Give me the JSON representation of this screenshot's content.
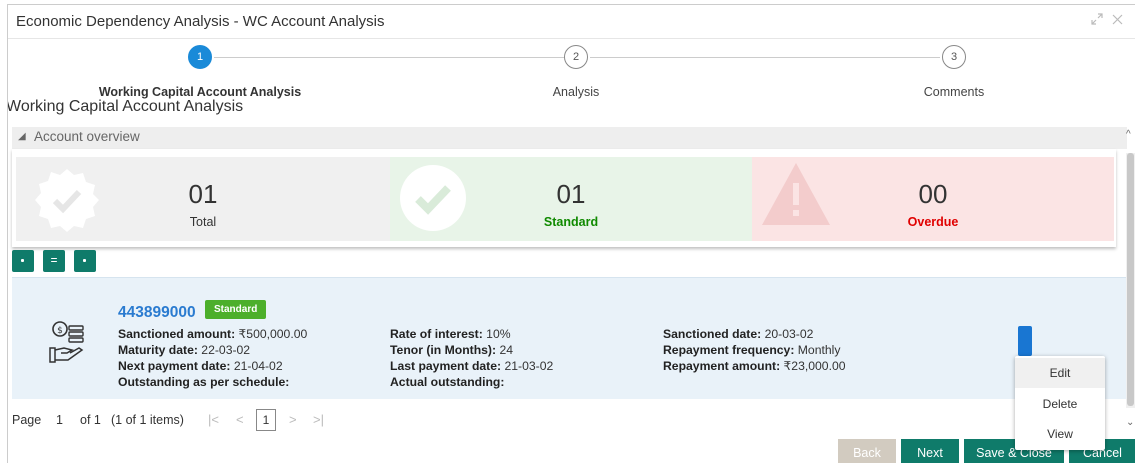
{
  "window": {
    "title": "Economic Dependency Analysis - WC Account Analysis"
  },
  "stepper": {
    "steps": [
      {
        "number": "1",
        "label": "Working Capital Account Analysis",
        "active": true
      },
      {
        "number": "2",
        "label": "Analysis",
        "active": false
      },
      {
        "number": "3",
        "label": "Comments",
        "active": false
      }
    ]
  },
  "page_heading": "Working Capital Account Analysis",
  "overview": {
    "section_label": "Account overview",
    "cards": [
      {
        "count": "01",
        "label": "Total",
        "color": "#f0f0f0",
        "label_color": "#333333"
      },
      {
        "count": "01",
        "label": "Standard",
        "color": "#e8f4e8",
        "label_color": "#108a00"
      },
      {
        "count": "00",
        "label": "Overdue",
        "color": "#fbe4e4",
        "label_color": "#e00000"
      }
    ]
  },
  "account": {
    "number": "443899000",
    "status": "Standard",
    "fields": {
      "sanctioned_amount_label": "Sanctioned amount:",
      "sanctioned_amount_value": "₹500,000.00",
      "maturity_date_label": "Maturity date:",
      "maturity_date_value": "22-03-02",
      "next_payment_date_label": "Next payment date:",
      "next_payment_date_value": "21-04-02",
      "outstanding_schedule_label": "Outstanding as per schedule:",
      "rate_of_interest_label": "Rate of interest:",
      "rate_of_interest_value": "10%",
      "tenor_label": "Tenor (in Months):",
      "tenor_value": "24",
      "last_payment_date_label": "Last payment date:",
      "last_payment_date_value": "21-03-02",
      "actual_outstanding_label": "Actual outstanding:",
      "sanctioned_date_label": "Sanctioned date:",
      "sanctioned_date_value": "20-03-02",
      "repayment_frequency_label": "Repayment frequency:",
      "repayment_frequency_value": "Monthly",
      "repayment_amount_label": "Repayment amount:",
      "repayment_amount_value": "₹23,000.00"
    }
  },
  "context_menu": {
    "items": [
      "Edit",
      "Delete",
      "View"
    ]
  },
  "pagination": {
    "page_label": "Page",
    "page_value": "1",
    "of_label": "of 1",
    "items_label": "(1 of 1 items)",
    "current_page": "1"
  },
  "footer": {
    "back_label": "Back",
    "next_label": "Next",
    "save_close_label": "Save & Close",
    "cancel_label": "Cancel"
  },
  "colors": {
    "accent": "#1a8ad8",
    "primary_button": "#0f7b6a",
    "badge_standard": "#4caf2b",
    "account_link": "#2a7bd0"
  }
}
